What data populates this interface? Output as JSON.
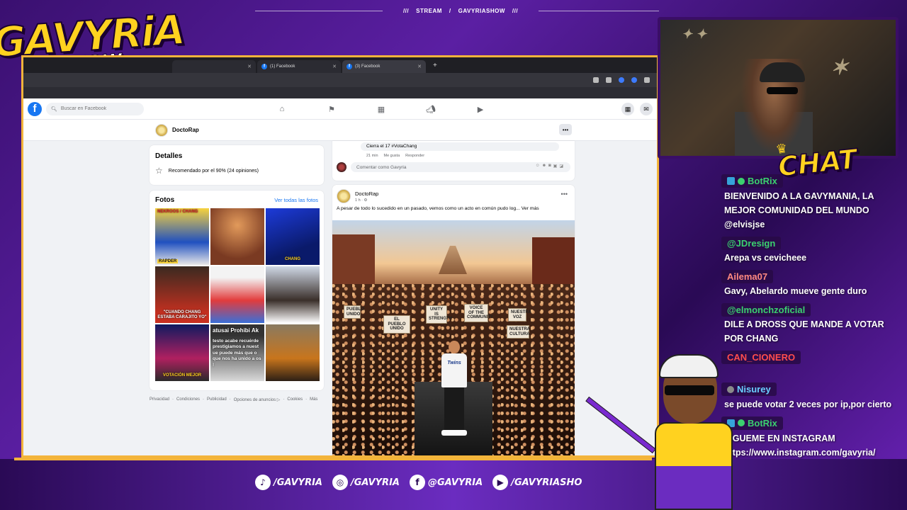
{
  "stream_banner": {
    "left": "///",
    "stream": "STREAM",
    "sep": "/",
    "show": "GAVYRIASHOW",
    "right": "///"
  },
  "logo": {
    "main": "GAVYRiA",
    "sub": "SHOW"
  },
  "browser": {
    "tabs": [
      {
        "label": "",
        "active": false
      },
      {
        "label": "(1) Facebook",
        "active": false
      },
      {
        "label": "(3) Facebook",
        "active": true
      }
    ],
    "new_tab": "+"
  },
  "facebook": {
    "logo": "f",
    "search_placeholder": "Buscar en Facebook",
    "nav_icons": [
      "home-icon",
      "flag-icon",
      "marketplace-icon",
      "megaphone-icon",
      "video-icon"
    ],
    "page_name": "DoctoRap",
    "page_more": "•••",
    "details": {
      "title": "Detalles",
      "recommendation": "Recomendado por el 90% (24 opiniones)"
    },
    "photos": {
      "title": "Fotos",
      "see_all": "Ver todas las fotos",
      "captions": {
        "p1_top": "NEKROOS / CHANG",
        "p1_bottom": "RAPDER",
        "p3": "CHANG",
        "p4": "\"CUANDO CHANG ESTABA CARAJITO YO\"",
        "p7": "VOTACIÓN MEJOR",
        "p8_title": "atusai Prohibi Ak",
        "p8_text": "testo acabe recuérde prestigiamos a nuest ue puede más que o que nos ha unido a os !"
      }
    },
    "footer": [
      "Privacidad",
      "·",
      "Condiciones",
      "·",
      "Publicidad",
      "·",
      "Opciones de anuncios ▷",
      "·",
      "Cookies",
      "·",
      "Más"
    ],
    "comment": {
      "text": "Cierra el 17 #VotaChang",
      "time": "21 min",
      "like": "Me gusta",
      "reply": "Responder",
      "input_placeholder": "Comentar como Gavyria"
    },
    "post": {
      "author": "DoctoRap",
      "time": "1 h · ⚙",
      "text": "A pesar de todo lo sucedido en un pasado, vemos como un acto en común pudo log...",
      "see_more": "Ver más",
      "more": "•••",
      "image_signs": [
        "UNITY IS STRENGTH",
        "VOICE OF THE COMMUNITY",
        "NUESTRA VOZ",
        "EL PUEBLO UNIDO",
        "NUESTRA CULTURA",
        "PUEBLO UNIDO"
      ],
      "performer_shirt": "Twins"
    }
  },
  "chat": {
    "title": "CHAT",
    "messages": [
      {
        "user": "BotRix",
        "color": "#3bd16f",
        "badges": [
          "mod",
          "verified"
        ],
        "text": "BIENVENIDO A LA GAVYMANIA, LA MEJOR COMUNIDAD DEL MUNDO @elvisjse"
      },
      {
        "user": "@JDresign",
        "color": "#3bd16f",
        "badges": [],
        "text": "Arepa vs cevicheee"
      },
      {
        "user": "Ailema07",
        "color": "#ff8a80",
        "badges": [],
        "text": "Gavy, Abelardo mueve gente duro"
      },
      {
        "user": "@elmonchzoficial",
        "color": "#3bd16f",
        "badges": [],
        "text": "DILE A DROSS QUE MANDE A VOTAR POR CHANG"
      },
      {
        "user": "CAN_CIONERO",
        "color": "#ff4d4d",
        "badges": [],
        "text": ""
      },
      {
        "user": "Nisurey",
        "color": "#6ad0ff",
        "badges": [
          "gray"
        ],
        "text": "se puede votar 2 veces por ip,por cierto"
      },
      {
        "user": "BotRix",
        "color": "#3bd16f",
        "badges": [
          "mod",
          "verified"
        ],
        "text": "SIGUEME EN INSTAGRAM https://www.instagram.com/gavyria/"
      }
    ]
  },
  "socials": [
    {
      "icon": "tiktok-icon",
      "glyph": "♪",
      "handle": "/GAVYRIA"
    },
    {
      "icon": "instagram-icon",
      "glyph": "◎",
      "handle": "/GAVYRIA"
    },
    {
      "icon": "facebook-icon",
      "glyph": "f",
      "handle": "@GAVYRIA"
    },
    {
      "icon": "youtube-icon",
      "glyph": "▶",
      "handle": "/GAVYRIASHO"
    }
  ],
  "colors": {
    "fb_blue": "#1877f2",
    "brand_yellow": "#ffd21f",
    "brand_purple": "#5b1fa3",
    "frame_gold": "#f3b43b"
  }
}
